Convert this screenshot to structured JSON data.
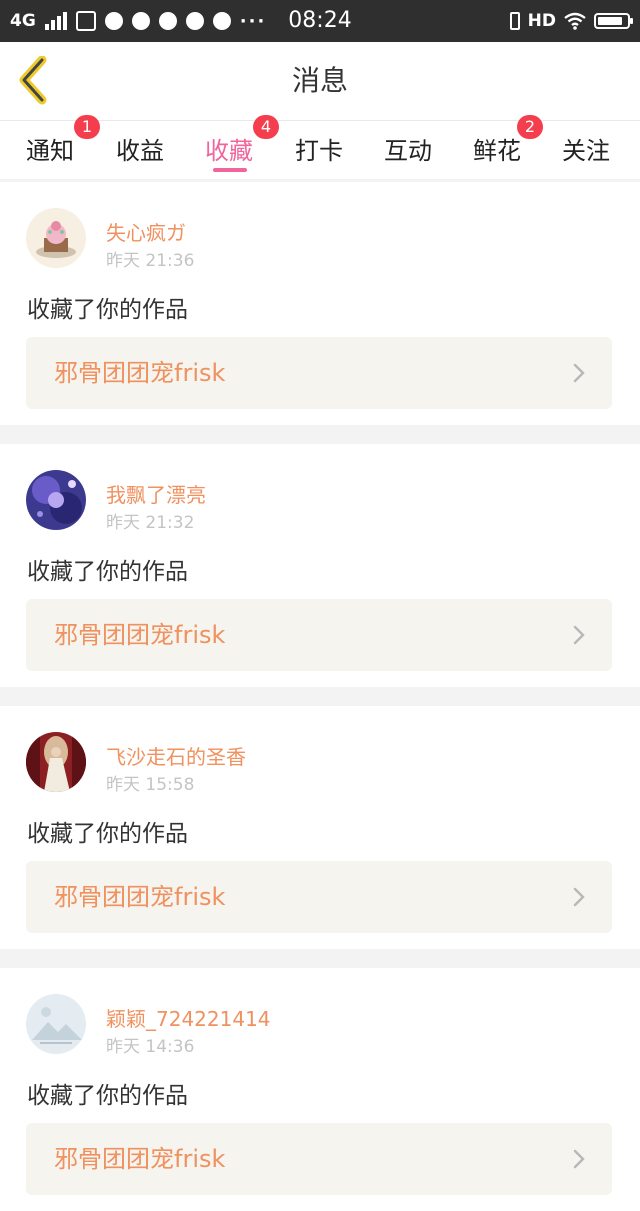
{
  "status_bar": {
    "network": "4G",
    "time": "08:24",
    "hd": "HD",
    "more": "···"
  },
  "header": {
    "title": "消息"
  },
  "tabs": [
    {
      "label": "通知",
      "badge": "1"
    },
    {
      "label": "收益",
      "badge": ""
    },
    {
      "label": "收藏",
      "badge": "4",
      "active": true
    },
    {
      "label": "打卡",
      "badge": ""
    },
    {
      "label": "互动",
      "badge": ""
    },
    {
      "label": "鲜花",
      "badge": "2"
    },
    {
      "label": "关注",
      "badge": ""
    }
  ],
  "colors": {
    "accent": "#f0659c",
    "badge": "#f43e4e",
    "username": "#f0915f",
    "work_bg": "#f5f4ee"
  },
  "messages": [
    {
      "username": "失心疯ガ",
      "time": "昨天 21:36",
      "action": "收藏了你的作品",
      "work_title": "邪骨团团宠frisk",
      "avatar": "cupcake-avatar"
    },
    {
      "username": "我飘了漂亮",
      "time": "昨天 21:32",
      "action": "收藏了你的作品",
      "work_title": "邪骨团团宠frisk",
      "avatar": "purple-anime-avatar"
    },
    {
      "username": "飞沙走石的圣香",
      "time": "昨天 15:58",
      "action": "收藏了你的作品",
      "work_title": "邪骨团团宠frisk",
      "avatar": "bride-avatar"
    },
    {
      "username": "颖颖_724221414",
      "time": "昨天 14:36",
      "action": "收藏了你的作品",
      "work_title": "邪骨团团宠frisk",
      "avatar": "default-avatar"
    }
  ]
}
